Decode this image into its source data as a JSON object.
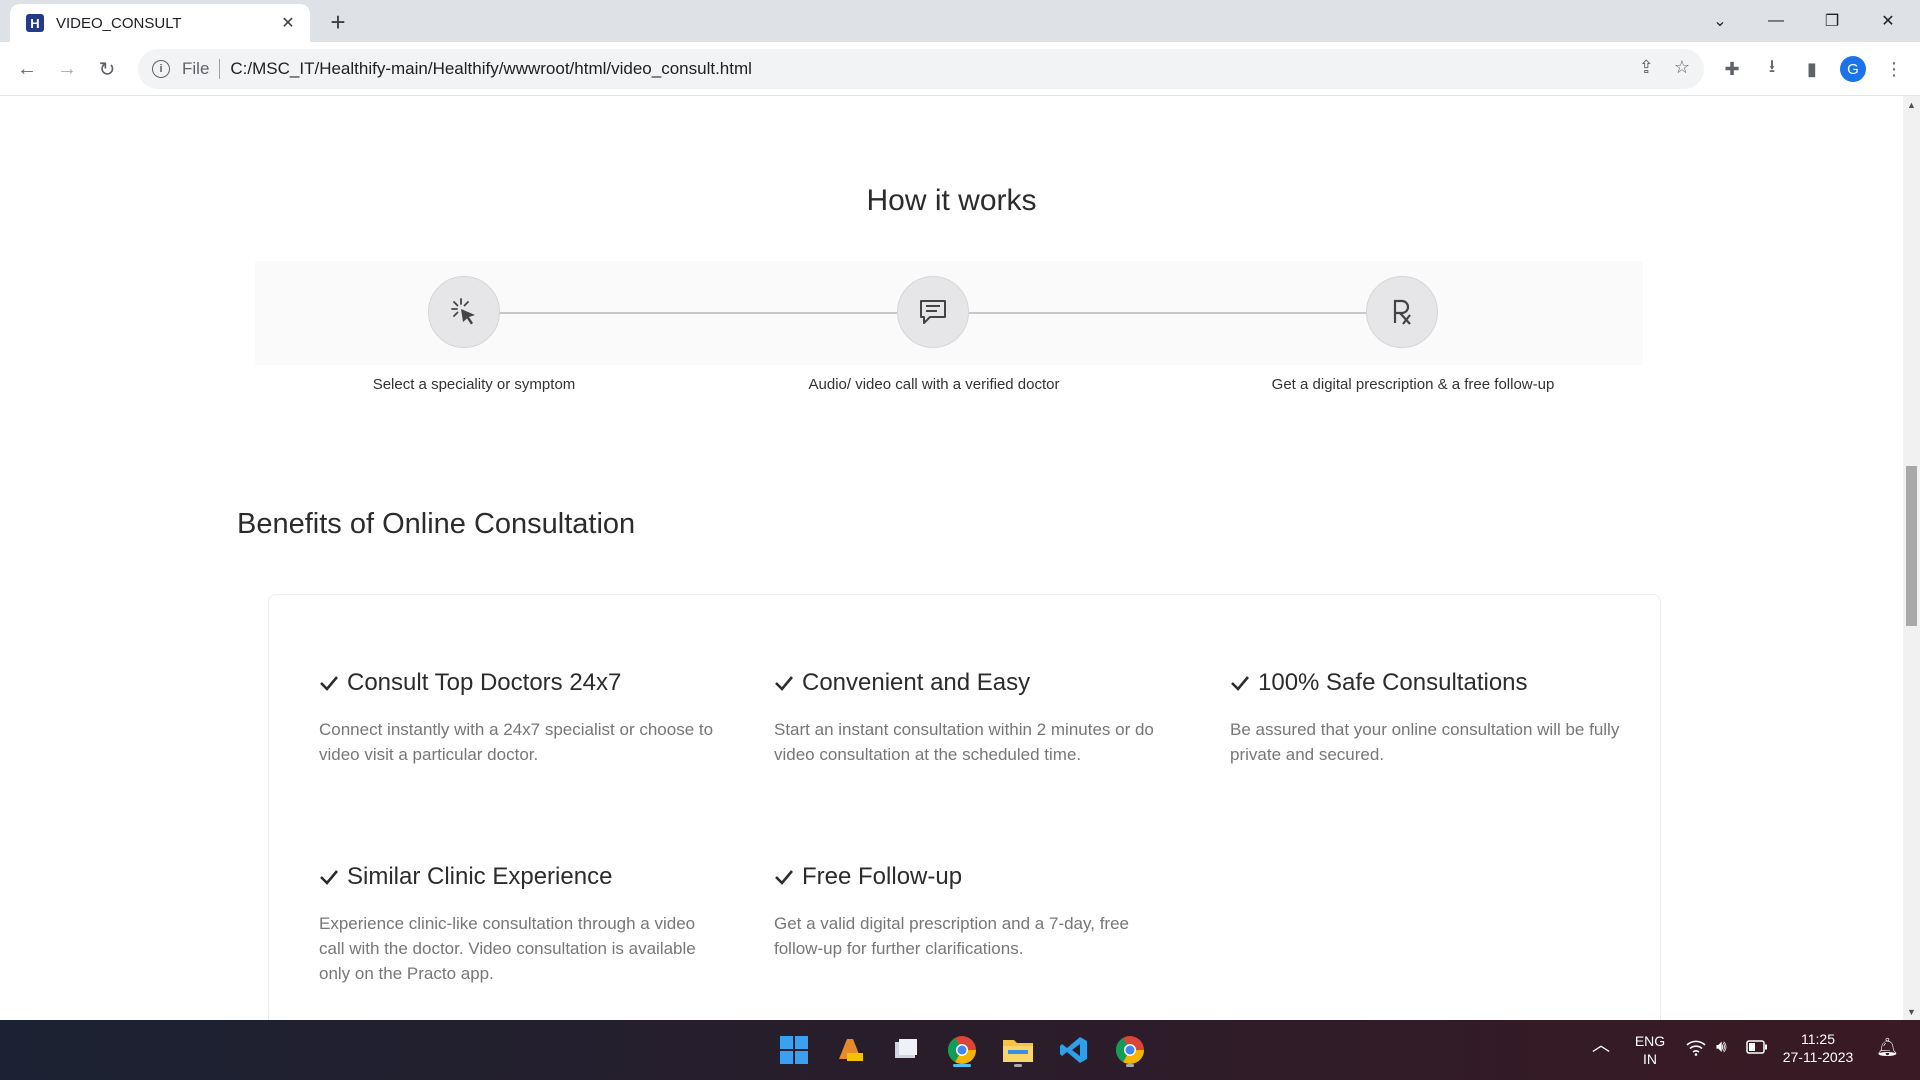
{
  "browser": {
    "tab_title": "VIDEO_CONSULT",
    "favicon_letter": "H",
    "url_scheme": "File",
    "url": "C:/MSC_IT/Healthify-main/Healthify/wwwroot/html/video_consult.html",
    "profile_initial": "G"
  },
  "how_it_works": {
    "title": "How it works",
    "steps": [
      {
        "label": "Select a speciality or symptom",
        "icon": "pointer-click-icon"
      },
      {
        "label": "Audio/ video call with a verified doctor",
        "icon": "chat-bubble-icon"
      },
      {
        "label": "Get a digital prescription & a free follow-up",
        "icon": "prescription-rx-icon"
      }
    ]
  },
  "benefits": {
    "title": "Benefits of Online Consultation",
    "items": [
      {
        "title": "Consult Top Doctors 24x7",
        "desc": "Connect instantly with a 24x7 specialist or choose to video visit a particular doctor."
      },
      {
        "title": "Convenient and Easy",
        "desc": "Start an instant consultation within 2 minutes or do video consultation at the scheduled time."
      },
      {
        "title": "100% Safe Consultations",
        "desc": "Be assured that your online consultation will be fully private and secured."
      },
      {
        "title": "Similar Clinic Experience",
        "desc": "Experience clinic-like consultation through a video call with the doctor. Video consultation is available only on the Practo app."
      },
      {
        "title": "Free Follow-up",
        "desc": "Get a valid digital prescription and a 7-day, free follow-up for further clarifications."
      }
    ]
  },
  "taskbar": {
    "language_line1": "ENG",
    "language_line2": "IN",
    "time": "11:25",
    "date": "27-11-2023"
  },
  "colors": {
    "accent_blue": "#1a73e8",
    "favicon_bg": "#263a8a"
  }
}
